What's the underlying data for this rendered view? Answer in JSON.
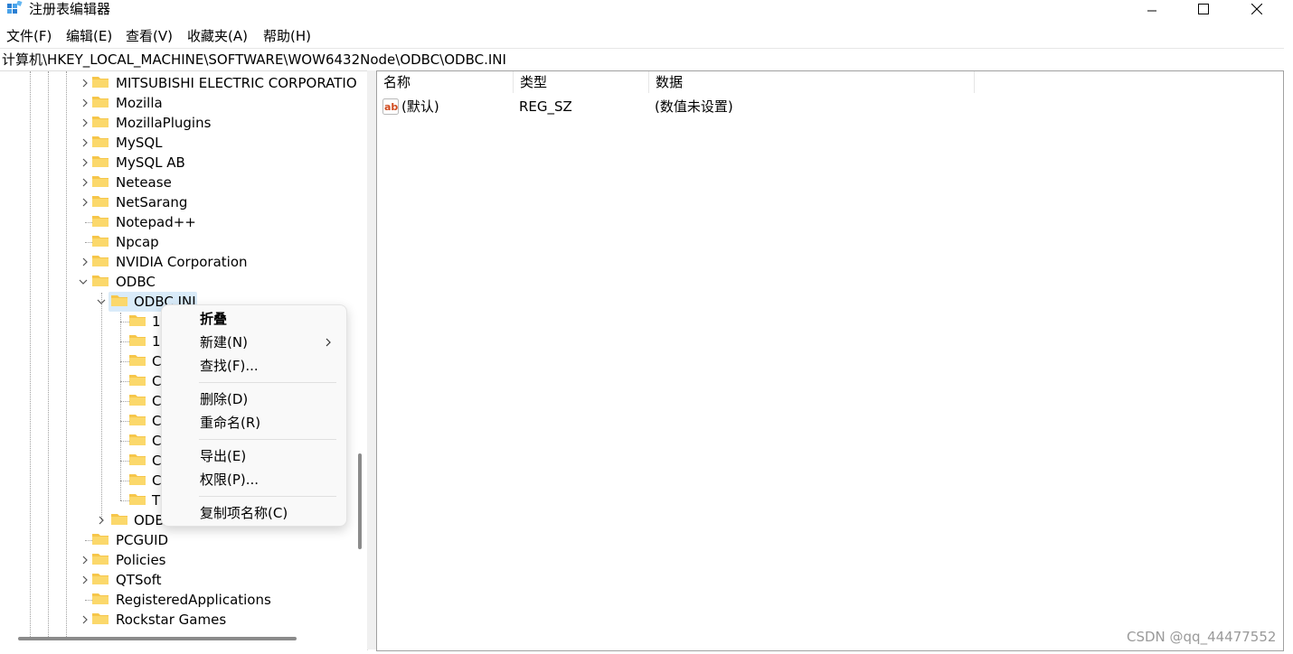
{
  "window": {
    "title": "注册表编辑器"
  },
  "menubar": {
    "items": [
      "文件(F)",
      "编辑(E)",
      "查看(V)",
      "收藏夹(A)",
      "帮助(H)"
    ]
  },
  "address": {
    "path": "计算机\\HKEY_LOCAL_MACHINE\\SOFTWARE\\WOW6432Node\\ODBC\\ODBC.INI"
  },
  "tree": {
    "items": [
      "MITSUBISHI ELECTRIC CORPORATIO",
      "Mozilla",
      "MozillaPlugins",
      "MySQL",
      "MySQL AB",
      "Netease",
      "NetSarang",
      "Notepad++",
      "Npcap",
      "NVIDIA Corporation",
      "ODBC",
      "ODBC.INI",
      "1",
      "1",
      "C",
      "C",
      "C",
      "C",
      "C",
      "C",
      "C",
      "T",
      "ODBC",
      "PCGUID",
      "Policies",
      "QTSoft",
      "RegisteredApplications",
      "Rockstar Games"
    ]
  },
  "list": {
    "columns": [
      "名称",
      "类型",
      "数据"
    ],
    "rows": [
      {
        "name": "(默认)",
        "type": "REG_SZ",
        "data": "(数值未设置)"
      }
    ]
  },
  "context_menu": {
    "collapse": "折叠",
    "new": "新建(N)",
    "find": "查找(F)...",
    "delete": "删除(D)",
    "rename": "重命名(R)",
    "export": "导出(E)",
    "permissions": "权限(P)...",
    "copy_key_name": "复制项名称(C)"
  },
  "watermark": "CSDN @qq_44477552",
  "colors": {
    "selection": "#d9ebf9",
    "folder": "#f6c64a",
    "menu_bg": "#f9f9f9"
  }
}
